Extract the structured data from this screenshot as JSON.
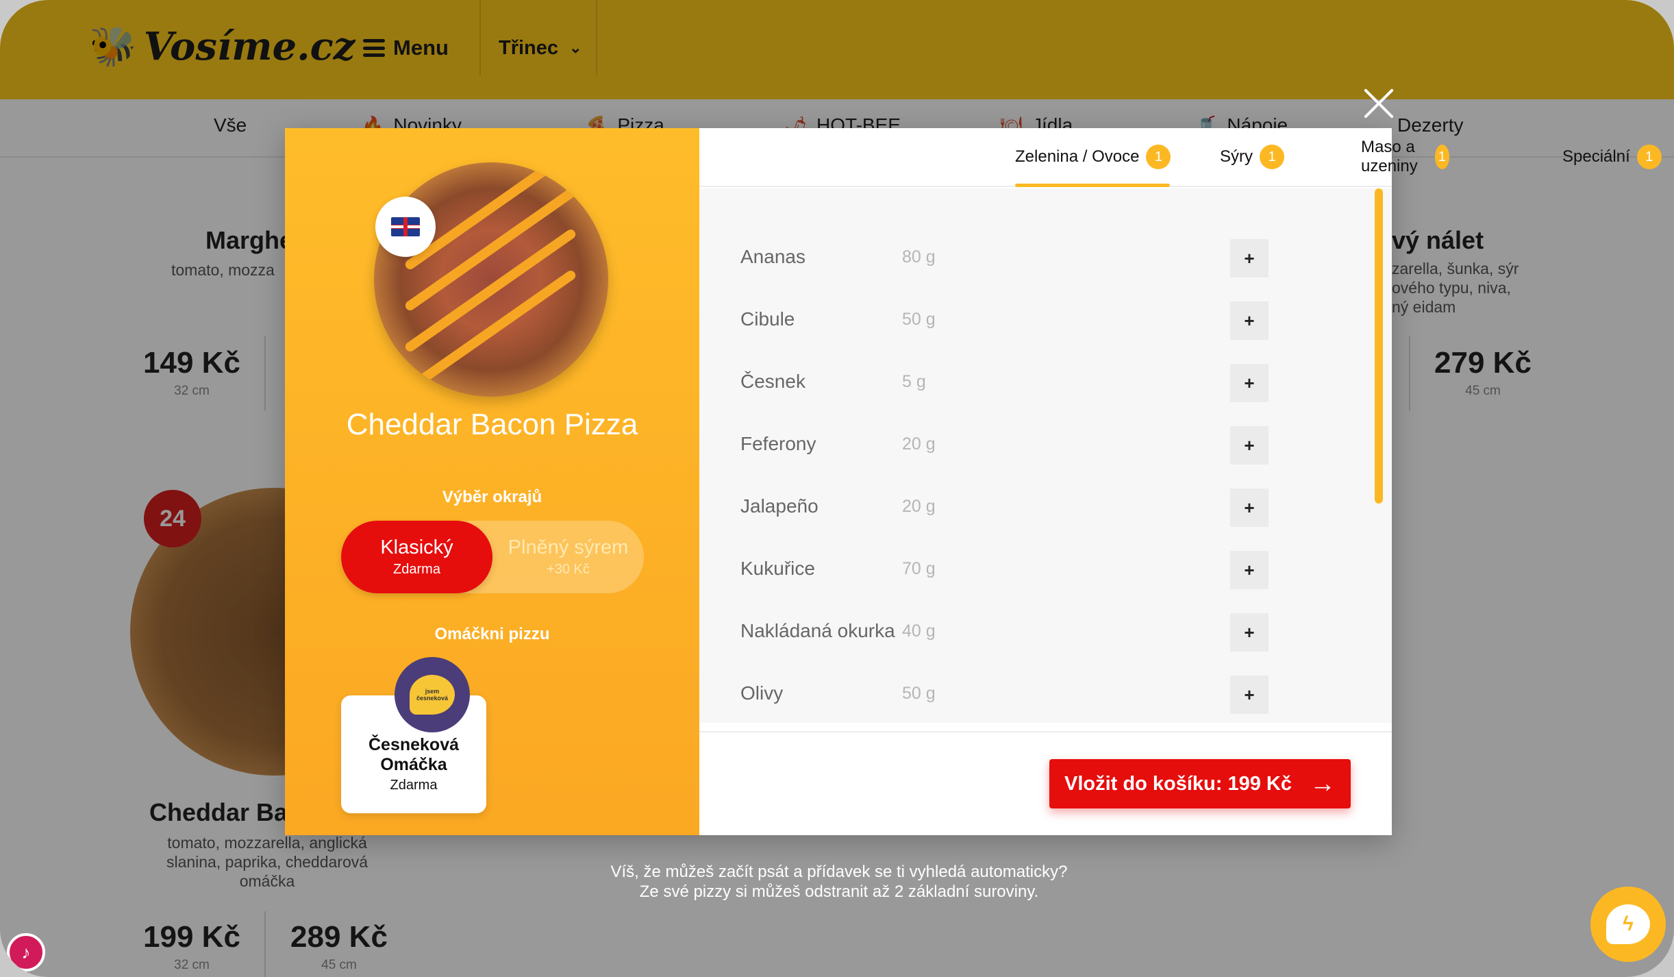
{
  "header": {
    "brand": "Vosíme.cz",
    "menu_label": "Menu",
    "city": "Třinec"
  },
  "categories": [
    "Vše",
    "Novinky",
    "Pizza",
    "HOT-BEE",
    "Jídla",
    "Nápoje",
    "Dezerty"
  ],
  "background_products": {
    "p1_title": "Marghe",
    "p1_desc": "tomato, mozza",
    "p1_price": "149 Kč",
    "p1_size": "32 cm",
    "p2_title": "vý nálet",
    "p2_desc_1": "zarella, šunka, sýr",
    "p2_desc_2": "ového typu, niva,",
    "p2_desc_3": "ný eidam",
    "p2_price": "279 Kč",
    "p2_size": "45 cm",
    "p3_badge": "24",
    "p3_title": "Cheddar Bac",
    "p3_desc_1": "tomato, mozzarella, anglická",
    "p3_desc_2": "slanina, paprika, cheddarová",
    "p3_desc_3": "omáčka",
    "p3_price_1": "199 Kč",
    "p3_size_1": "32 cm",
    "p3_price_2": "289 Kč",
    "p3_size_2": "45 cm"
  },
  "modal": {
    "pizza_name": "Cheddar Bacon Pizza",
    "crust_label": "Výběr okrajů",
    "crust_options": [
      {
        "title": "Klasický",
        "sub": "Zdarma"
      },
      {
        "title": "Plněný sýrem",
        "sub": "+30 Kč"
      }
    ],
    "sauce_label": "Omáčkni pizzu",
    "sauce": {
      "name_1": "Česneková",
      "name_2": "Omáčka",
      "price": "Zdarma",
      "logo_text": "jsem česneková"
    },
    "tabs": [
      {
        "label": "Zelenina / Ovoce",
        "count": "1"
      },
      {
        "label": "Sýry",
        "count": "1"
      },
      {
        "label": "Maso a uzeniny",
        "count": "1"
      },
      {
        "label": "Speciální",
        "count": "1"
      }
    ],
    "ingredients": [
      {
        "name": "Ananas",
        "weight": "80 g"
      },
      {
        "name": "Cibule",
        "weight": "50 g"
      },
      {
        "name": "Česnek",
        "weight": "5 g"
      },
      {
        "name": "Feferony",
        "weight": "20 g"
      },
      {
        "name": "Jalapeño",
        "weight": "20 g"
      },
      {
        "name": "Kukuřice",
        "weight": "70 g"
      },
      {
        "name": "Nakládaná okurka",
        "weight": "40 g"
      },
      {
        "name": "Olivy",
        "weight": "50 g"
      }
    ],
    "plus_label": "+",
    "cart_button": "Vložit do košíku: 199 Kč"
  },
  "hint": {
    "line1": "Víš, že můžeš začít psát a přídavek se ti vyhledá automaticky?",
    "line2": "Ze své pizzy si můžeš odstranit až 2 základní suroviny."
  },
  "colors": {
    "brand_yellow": "#ffcc1d",
    "accent_orange": "#fcb823",
    "cta_red": "#e60d0d"
  }
}
